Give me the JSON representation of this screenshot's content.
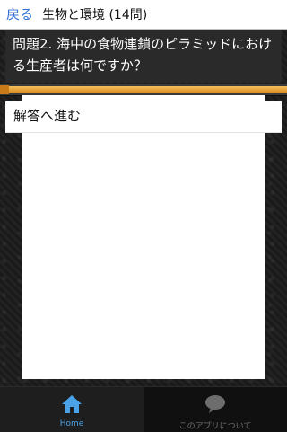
{
  "header": {
    "back_label": "戻る",
    "title": "生物と環境 (14問)"
  },
  "question": {
    "text": "問題2. 海中の食物連鎖のピラミッドにおける生産者は何ですか？"
  },
  "progress": {
    "fraction": 1.0,
    "color": "#e8a23a"
  },
  "answer_button": {
    "label": "解答へ進む"
  },
  "tabbar": {
    "tabs": [
      {
        "label": "Home",
        "icon": "home-icon",
        "active": true,
        "color": "#4aa3e8"
      },
      {
        "label": "このアプリについて",
        "icon": "speech-bubble-icon",
        "active": false,
        "color": "#6d6d6d"
      }
    ]
  },
  "colors": {
    "accent_blue": "#2f6fd6",
    "background": "#1c1c1c"
  }
}
